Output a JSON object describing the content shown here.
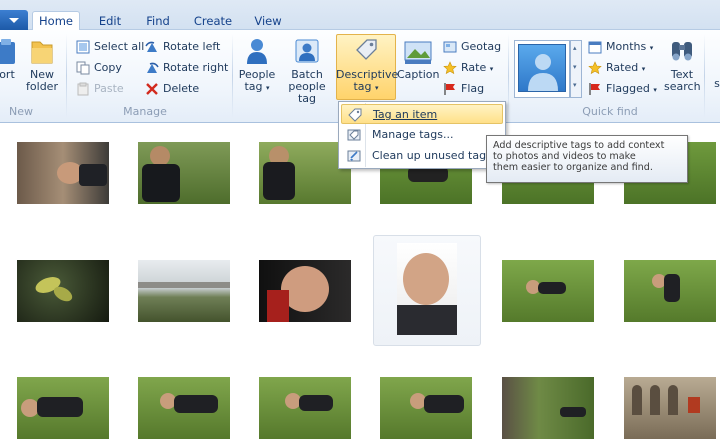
{
  "tabs": [
    "Home",
    "Edit",
    "Find",
    "Create",
    "View"
  ],
  "ribbon": {
    "new_group": {
      "label": "New",
      "import_partial": "ort",
      "new_folder_line1": "New",
      "new_folder_line2": "folder"
    },
    "manage_group": {
      "label": "Manage",
      "select_all": "Select all",
      "copy": "Copy",
      "paste": "Paste",
      "rotate_left": "Rotate left",
      "rotate_right": "Rotate right",
      "delete": "Delete"
    },
    "organize_group": {
      "people_tag_line1": "People",
      "people_tag_line2": "tag",
      "batch_line1": "Batch",
      "batch_line2": "people tag",
      "descriptive_line1": "Descriptive",
      "descriptive_line2": "tag",
      "caption": "Caption",
      "geotag": "Geotag",
      "rate": "Rate",
      "flag": "Flag"
    },
    "quickfind_group": {
      "label": "Quick find",
      "months": "Months",
      "rated": "Rated",
      "flagged": "Flagged",
      "text_search_line1": "Text",
      "text_search_line2": "search",
      "partial_s": "s"
    }
  },
  "menu": {
    "items": [
      "Tag an item",
      "Manage tags...",
      "Clean up unused tags"
    ]
  },
  "tooltip": {
    "line1": "Add descriptive tags to add context",
    "line2": "to photos and videos to make",
    "line3": "them easier to organize and find."
  },
  "colors": {
    "ribbon_accent": "#15428b",
    "highlight": "#ffd36b",
    "grass": "#5f8a2e"
  }
}
